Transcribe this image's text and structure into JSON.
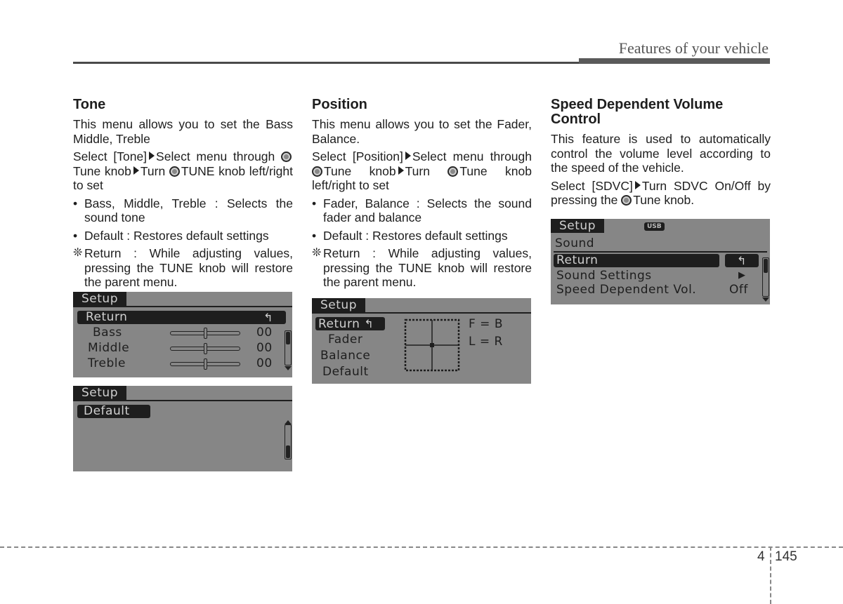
{
  "header": {
    "title": "Features of your vehicle"
  },
  "sections": {
    "tone": {
      "heading": "Tone",
      "intro": "This menu allows you to set the Bass Middle, Treble",
      "step_a": "Select [Tone]",
      "step_b": "Select menu through",
      "step_c": "Tune knob",
      "step_d": "Turn",
      "step_e": "TUNE knob left/right to set",
      "bullets": [
        "Bass, Middle, Treble : Selects the sound tone",
        "Default : Restores default settings"
      ],
      "note_symbol": "❊",
      "note": "Return : While adjusting values, pressing the TUNE knob will restore the parent menu."
    },
    "position": {
      "heading": "Position",
      "intro": "This menu allows you to set the Fader, Balance.",
      "step_a": "Select [Position]",
      "step_b": "Select menu through",
      "step_c": "Tune knob",
      "step_d": "Turn",
      "step_e": "Tune knob left/right to set",
      "bullets": [
        "Fader, Balance : Selects the sound fader and balance",
        "Default : Restores default settings"
      ],
      "note_symbol": "❊",
      "note": "Return : While adjusting values, pressing the TUNE knob will restore the parent menu."
    },
    "sdvc": {
      "heading": "Speed Dependent Volume Control",
      "intro": "This feature is used to automatically control the volume level according to the speed of the vehicle.",
      "step_a": "Select [SDVC]",
      "step_b": "Turn SDVC On/Off by pressing the",
      "step_c": "Tune knob."
    }
  },
  "screens": {
    "tone": {
      "tab": "Setup",
      "selected": "Return",
      "return_icon": "↰",
      "rows": [
        {
          "label": "Bass",
          "value": "00",
          "level": 0.5
        },
        {
          "label": "Middle",
          "value": "00",
          "level": 0.5
        },
        {
          "label": "Treble",
          "value": "00",
          "level": 0.5
        }
      ],
      "scroll_position": 0.0
    },
    "tone_default": {
      "tab": "Setup",
      "selected": "Default",
      "scroll_position": 1.0
    },
    "position": {
      "tab": "Setup",
      "selected": "Return",
      "return_icon": "↰",
      "items": [
        "Fader",
        "Balance",
        "Default"
      ],
      "readouts": [
        "F = B",
        "L = R"
      ],
      "fader": 0.5,
      "balance": 0.5
    },
    "sdvc": {
      "tab": "Setup",
      "badge": "USB",
      "subtitle": "Sound",
      "selected": "Return",
      "return_icon": "↰",
      "rows": [
        {
          "label": "Sound Settings",
          "value": "▶"
        },
        {
          "label": "Speed Dependent Vol.",
          "value": "Off"
        }
      ],
      "scroll_position": 0.0
    }
  },
  "footer": {
    "chapter": "4",
    "page": "145"
  }
}
